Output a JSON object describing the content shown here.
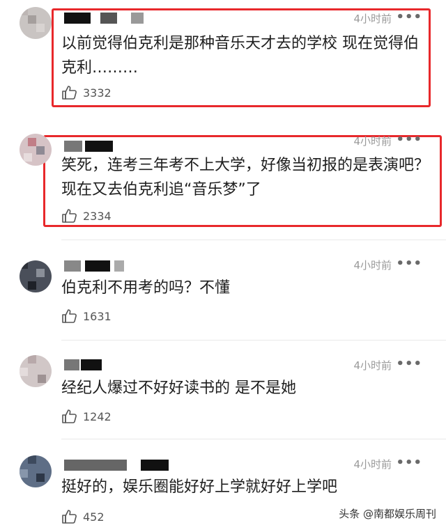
{
  "comments": [
    {
      "time": "4小时前",
      "more": "•••",
      "text": "以前觉得伯克利是那种音乐天才去的学校 现在觉得伯克利………",
      "likes": "3332",
      "highlighted": true
    },
    {
      "time": "4小时前",
      "more": "•••",
      "text": "笑死，连考三年考不上大学，好像当初报的是表演吧？现在又去伯克利追“音乐梦”了",
      "likes": "2334",
      "highlighted": true
    },
    {
      "time": "4小时前",
      "more": "•••",
      "text": "伯克利不用考的吗？不懂",
      "likes": "1631",
      "highlighted": false
    },
    {
      "time": "4小时前",
      "more": "•••",
      "text": "经纪人爆过不好好读书的 是不是她",
      "likes": "1242",
      "highlighted": false
    },
    {
      "time": "4小时前",
      "more": "•••",
      "text": "挺好的，娱乐圈能好好上学就好好上学吧",
      "likes": "452",
      "highlighted": false
    }
  ],
  "watermark": "头条 @南都娱乐周刊",
  "colors": {
    "highlight": "#e8282b",
    "time": "#9a9a9a",
    "text": "#1e1e1e"
  },
  "icons": {
    "like": "thumbs-up-icon",
    "more": "more-dots-icon"
  }
}
